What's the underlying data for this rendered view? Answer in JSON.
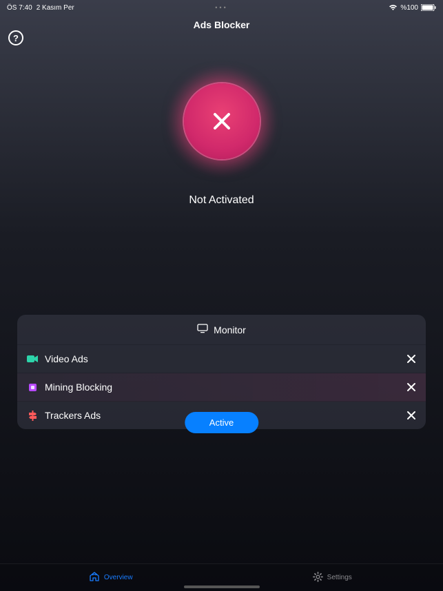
{
  "statusBar": {
    "time": "ÖS 7:40",
    "date": "2 Kasım Per",
    "dots": "•••",
    "battery": "%100"
  },
  "header": {
    "title": "Ads Blocker",
    "helpLabel": "?"
  },
  "main": {
    "statusText": "Not Activated"
  },
  "monitor": {
    "title": "Monitor",
    "items": [
      {
        "label": "Video Ads"
      },
      {
        "label": "Mining Blocking"
      },
      {
        "label": "Trackers Ads"
      }
    ],
    "activeButton": "Active"
  },
  "tabs": {
    "overview": "Overview",
    "settings": "Settings"
  }
}
